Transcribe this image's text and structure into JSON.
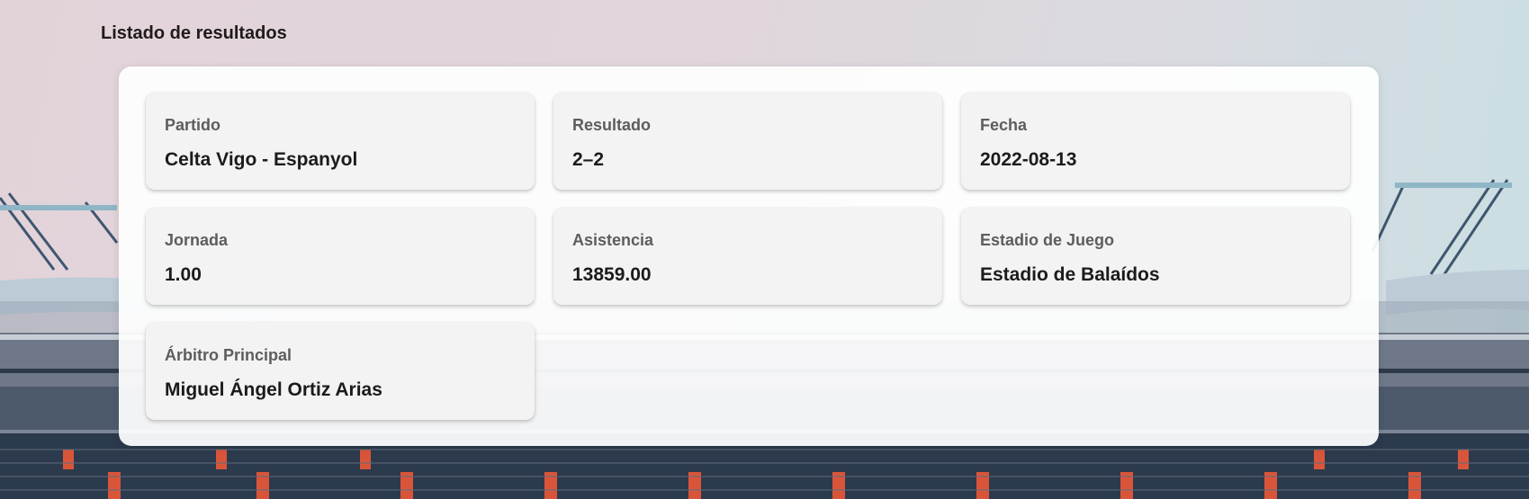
{
  "page": {
    "title": "Listado de resultados"
  },
  "result": {
    "fields": [
      {
        "label": "Partido",
        "value": "Celta Vigo - Espanyol"
      },
      {
        "label": "Resultado",
        "value": "2–2"
      },
      {
        "label": "Fecha",
        "value": "2022-08-13"
      },
      {
        "label": "Jornada",
        "value": "1.00"
      },
      {
        "label": "Asistencia",
        "value": "13859.00"
      },
      {
        "label": "Estadio de Juego",
        "value": "Estadio de Balaídos"
      },
      {
        "label": "Árbitro Principal",
        "value": "Miguel Ángel Ortiz Arias"
      }
    ]
  },
  "colors": {
    "card_background": "#f3f3f3",
    "label_text": "#5d5d5d",
    "value_text": "#1b1b1b",
    "seat_accent": "#d9553a"
  }
}
